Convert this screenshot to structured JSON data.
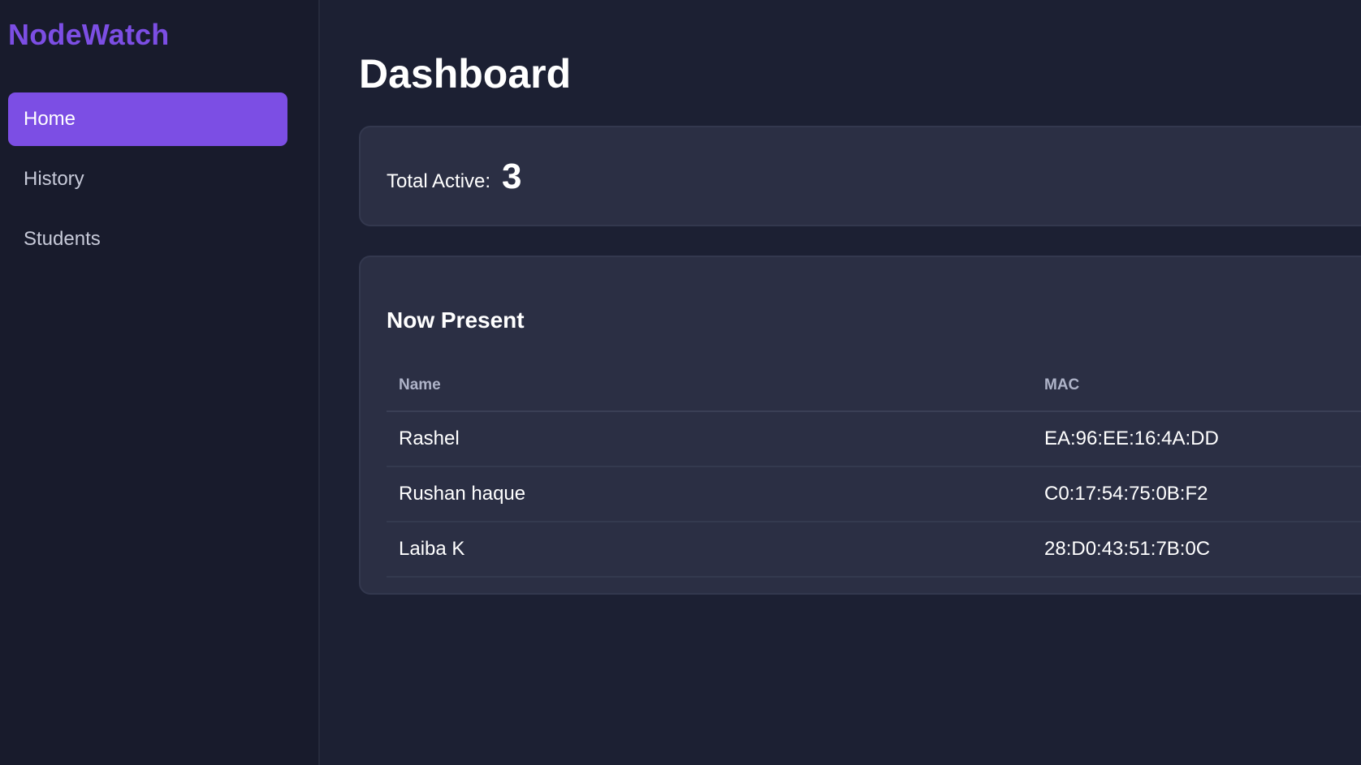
{
  "brand": "NodeWatch",
  "nav": {
    "items": [
      {
        "label": "Home",
        "active": true
      },
      {
        "label": "History",
        "active": false
      },
      {
        "label": "Students",
        "active": false
      }
    ]
  },
  "main": {
    "title": "Dashboard",
    "stats": {
      "label": "Total Active:",
      "value": "3"
    },
    "present": {
      "title": "Now Present",
      "columns": [
        "Name",
        "MAC"
      ],
      "rows": [
        {
          "name": "Rashel",
          "mac": "EA:96:EE:16:4A:DD"
        },
        {
          "name": "Rushan haque",
          "mac": "C0:17:54:75:0B:F2"
        },
        {
          "name": "Laiba K",
          "mac": "28:D0:43:51:7B:0C"
        }
      ]
    }
  },
  "colors": {
    "accent": "#7c4ee4",
    "background": "#1c2033",
    "sidebar": "#181b2c",
    "card": "#2b2f44"
  }
}
